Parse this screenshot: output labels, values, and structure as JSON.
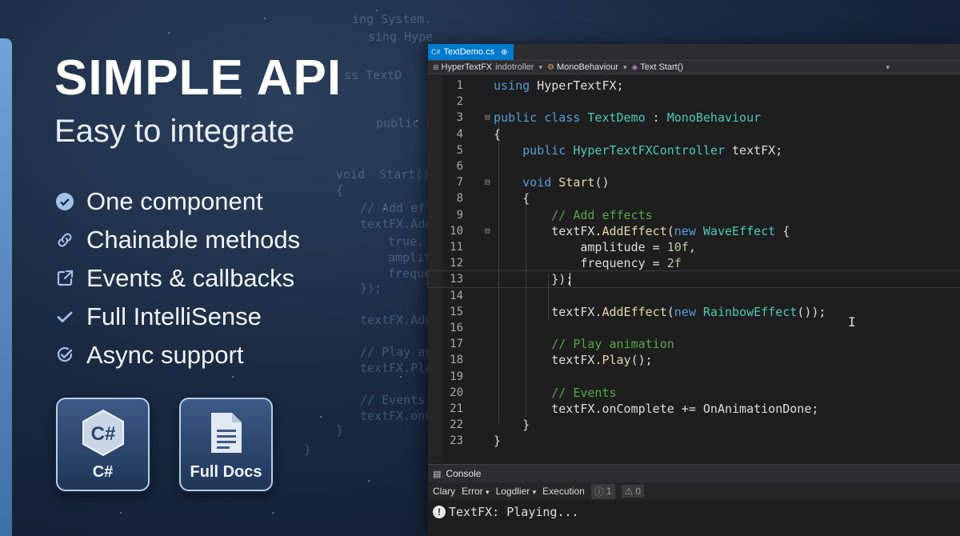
{
  "hero": {
    "title": "SIMPLE API",
    "subtitle": "Easy to integrate"
  },
  "features": [
    {
      "icon": "check-circle-icon",
      "label": "One component"
    },
    {
      "icon": "link-icon",
      "label": "Chainable methods"
    },
    {
      "icon": "external-link-icon",
      "label": "Events & callbacks"
    },
    {
      "icon": "checkmark-icon",
      "label": "Full IntelliSense"
    },
    {
      "icon": "check-circle-outline-icon",
      "label": "Async support"
    }
  ],
  "badges": [
    {
      "icon": "csharp-logo-icon",
      "label": "C#",
      "logo_text": "C#"
    },
    {
      "icon": "document-icon",
      "label": "Full Docs"
    }
  ],
  "background_code": [
    "ing System.V;",
    "sing HyperTextFX;",
    "ss TextD",
    "public HyperTex",
    "void  Start()",
    "{",
    "// Add effe",
    "textFX.AddE",
    "true,",
    "amplitu",
    "frequen",
    "});",
    "textFX.AddE",
    "// Play ani",
    "textFX.Play(",
    "// Events",
    "textFX.onCom",
    "}",
    "}"
  ],
  "ide": {
    "tab": {
      "label": "TextDemo.cs",
      "icon": "csharp-file-icon",
      "pin": "pin-icon"
    },
    "nav": {
      "project": "HyperTextFX",
      "project_suffix": "indotroller",
      "class": "MonoBehaviour",
      "member": "Text Start()"
    },
    "code_lines": [
      {
        "n": "1",
        "html": "<span class=\"kw\">using</span> HyperTextFX;"
      },
      {
        "n": "2",
        "html": ""
      },
      {
        "n": "3",
        "html": "<span class=\"kw\">public class</span> <span class=\"ty\">TextDemo</span> : <span class=\"ty\">MonoBehaviour</span>"
      },
      {
        "n": "4",
        "html": "{"
      },
      {
        "n": "5",
        "html": "    <span class=\"kw\">public</span> <span class=\"ty\">HyperTextFXController</span> textFX;"
      },
      {
        "n": "6",
        "html": ""
      },
      {
        "n": "7",
        "html": "    <span class=\"kw\">void</span> <span class=\"fn\">Start</span>()"
      },
      {
        "n": "8",
        "html": "    {"
      },
      {
        "n": "9",
        "html": "        <span class=\"cm\">// Add effects</span>"
      },
      {
        "n": "10",
        "html": "        textFX.<span class=\"fn\">AddEffect</span>(<span class=\"kw\">new</span> <span class=\"ty\">WaveEffect</span> {"
      },
      {
        "n": "11",
        "html": "            amplitude = <span class=\"nm\">10f</span>,"
      },
      {
        "n": "12",
        "html": "            frequency = <span class=\"nm\">2f</span>"
      },
      {
        "n": "13",
        "html": "        });"
      },
      {
        "n": "14",
        "html": ""
      },
      {
        "n": "15",
        "html": "        textFX.<span class=\"fn\">AddEffect</span>(<span class=\"kw\">new</span> <span class=\"ty\">RainbowEffect</span>());"
      },
      {
        "n": "16",
        "html": ""
      },
      {
        "n": "17",
        "html": "        <span class=\"cm\">// Play animation</span>"
      },
      {
        "n": "18",
        "html": "        textFX.<span class=\"fn\">Play</span>();"
      },
      {
        "n": "19",
        "html": ""
      },
      {
        "n": "20",
        "html": "        <span class=\"cm\">// Events</span>"
      },
      {
        "n": "21",
        "html": "        textFX.onComplete += OnAnimationDone;"
      },
      {
        "n": "22",
        "html": "    }"
      },
      {
        "n": "23",
        "html": "}"
      }
    ],
    "console": {
      "tab_label": "Console",
      "toolbar": {
        "clear": "Clary",
        "error": "Error",
        "log": "Logdlier",
        "execution": "Execution",
        "count1": "1",
        "count2": "0"
      },
      "message": "TextFX: Playing..."
    }
  }
}
